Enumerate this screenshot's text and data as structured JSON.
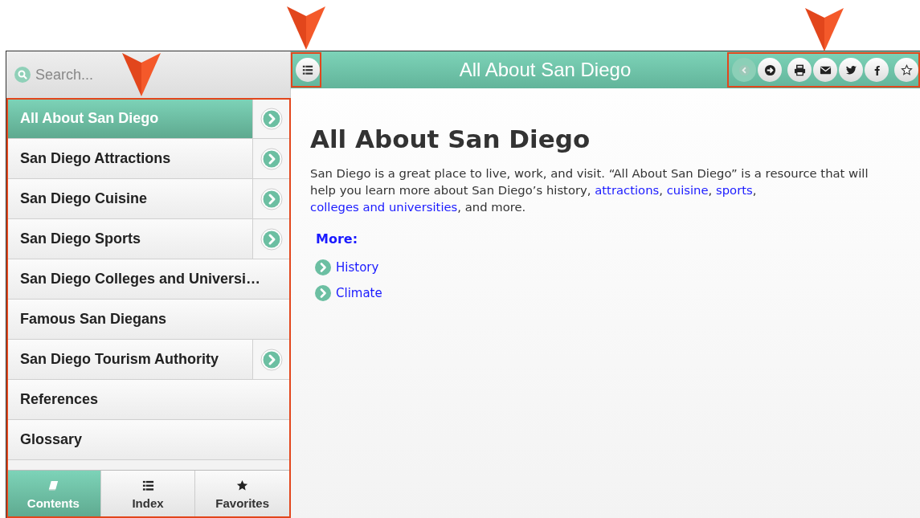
{
  "search": {
    "placeholder": "Search..."
  },
  "header": {
    "title": "All About San Diego"
  },
  "toolbar": [
    {
      "kind": "back",
      "disabled": true
    },
    {
      "kind": "forward",
      "disabled": false
    },
    {
      "kind": "print",
      "disabled": false
    },
    {
      "kind": "email",
      "disabled": false
    },
    {
      "kind": "twitter",
      "disabled": false
    },
    {
      "kind": "facebook",
      "disabled": false
    },
    {
      "kind": "favorite",
      "disabled": false
    }
  ],
  "toc": [
    {
      "label": "All About San Diego",
      "selected": true,
      "has_children": true
    },
    {
      "label": "San Diego Attractions",
      "selected": false,
      "has_children": true
    },
    {
      "label": "San Diego Cuisine",
      "selected": false,
      "has_children": true
    },
    {
      "label": "San Diego Sports",
      "selected": false,
      "has_children": true
    },
    {
      "label": "San Diego Colleges and Universi…",
      "selected": false,
      "has_children": false
    },
    {
      "label": "Famous San Diegans",
      "selected": false,
      "has_children": false
    },
    {
      "label": "San Diego Tourism Authority",
      "selected": false,
      "has_children": true
    },
    {
      "label": "References",
      "selected": false,
      "has_children": false
    },
    {
      "label": "Glossary",
      "selected": false,
      "has_children": false
    }
  ],
  "tabs": [
    {
      "label": "Contents",
      "kind": "book",
      "selected": true
    },
    {
      "label": "Index",
      "kind": "list",
      "selected": false
    },
    {
      "label": "Favorites",
      "kind": "star",
      "selected": false
    }
  ],
  "article": {
    "heading": "All About San Diego",
    "paragraph": [
      "San Diego is a great place to live, work, and visit. “All About San Diego” is a resource that will help you learn more about San Diego’s history, ",
      "attractions",
      ", ",
      "cuisine",
      ", ",
      "sports",
      ", ",
      "colleges and universities",
      ", and more."
    ],
    "more_heading": "More:",
    "more_links": [
      "History",
      "Climate"
    ]
  }
}
